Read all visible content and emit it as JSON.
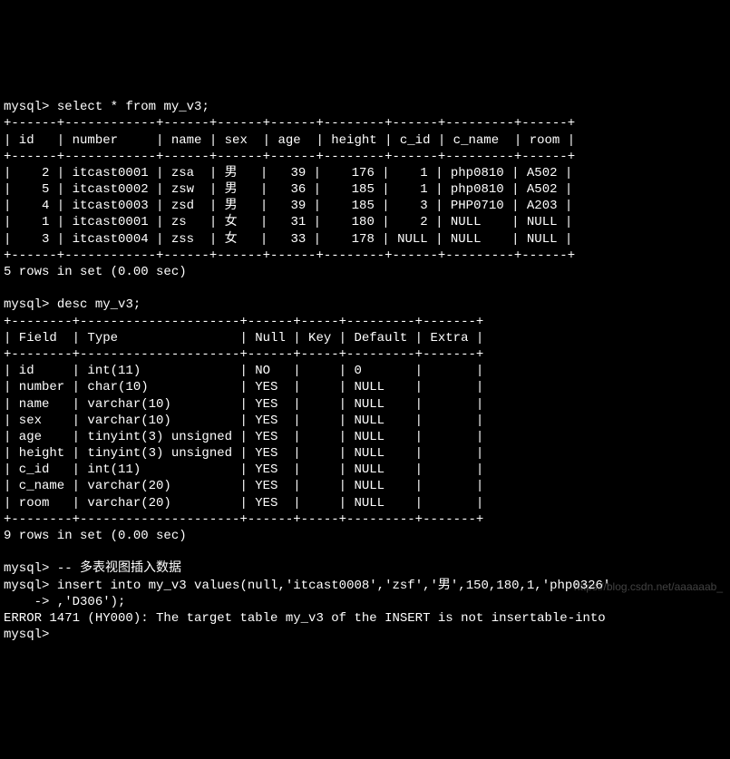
{
  "prompts": {
    "mysql": "mysql>",
    "cont": "    ->"
  },
  "queries": {
    "select": "select * from my_v3;",
    "desc": "desc my_v3;",
    "comment_insert": "-- 多表视图插入数据",
    "insert_l1": "insert into my_v3 values(null,'itcast0008','zsf','男',150,180,1,'php0326'",
    "insert_l2": ",'D306');"
  },
  "results": {
    "rows5": "5 rows in set (0.00 sec)",
    "rows9": "9 rows in set (0.00 sec)"
  },
  "error": {
    "line": "ERROR 1471 (HY000): The target table my_v3 of the INSERT is not insertable-into"
  },
  "table1": {
    "border": "+------+------------+------+------+------+--------+------+---------+------+",
    "header": "| id   | number     | name | sex  | age  | height | c_id | c_name  | room |",
    "rows": [
      "|    2 | itcast0001 | zsa  | 男   |   39 |    176 |    1 | php0810 | A502 |",
      "|    5 | itcast0002 | zsw  | 男   |   36 |    185 |    1 | php0810 | A502 |",
      "|    4 | itcast0003 | zsd  | 男   |   39 |    185 |    3 | PHP0710 | A203 |",
      "|    1 | itcast0001 | zs   | 女   |   31 |    180 |    2 | NULL    | NULL |",
      "|    3 | itcast0004 | zss  | 女   |   33 |    178 | NULL | NULL    | NULL |"
    ]
  },
  "table2": {
    "border": "+--------+---------------------+------+-----+---------+-------+",
    "header": "| Field  | Type                | Null | Key | Default | Extra |",
    "rows": [
      "| id     | int(11)             | NO   |     | 0       |       |",
      "| number | char(10)            | YES  |     | NULL    |       |",
      "| name   | varchar(10)         | YES  |     | NULL    |       |",
      "| sex    | varchar(10)         | YES  |     | NULL    |       |",
      "| age    | tinyint(3) unsigned | YES  |     | NULL    |       |",
      "| height | tinyint(3) unsigned | YES  |     | NULL    |       |",
      "| c_id   | int(11)             | YES  |     | NULL    |       |",
      "| c_name | varchar(20)         | YES  |     | NULL    |       |",
      "| room   | varchar(20)         | YES  |     | NULL    |       |"
    ]
  },
  "watermark": "https://blog.csdn.net/aaaaaab_"
}
